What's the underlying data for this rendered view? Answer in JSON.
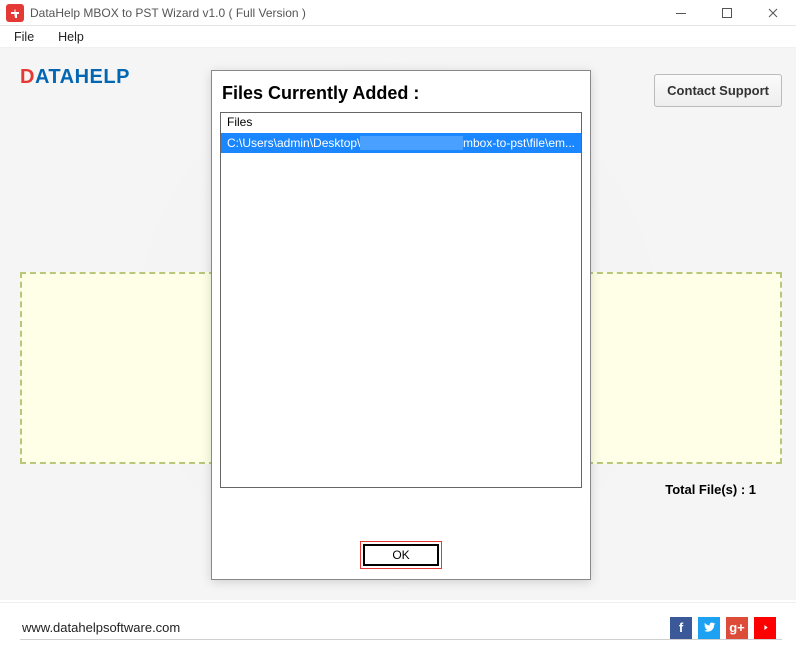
{
  "titlebar": {
    "text": "DataHelp MBOX to PST Wizard v1.0 ( Full Version )"
  },
  "menu": {
    "file": "File",
    "help": "Help"
  },
  "logo": {
    "d": "D",
    "rest": "ATAHELP"
  },
  "contact": {
    "label": "Contact Support"
  },
  "totals": {
    "label": "Total File(s) : 1"
  },
  "modal": {
    "title": "Files Currently Added :",
    "column": "Files",
    "row_prefix": "C:\\Users\\admin\\Desktop\\",
    "row_suffix": "mbox-to-pst\\file\\em...",
    "ok": "OK"
  },
  "footer": {
    "url": "www.datahelpsoftware.com"
  },
  "social": {
    "fb": "f",
    "tw": "",
    "gp": "g+",
    "yt": ""
  }
}
